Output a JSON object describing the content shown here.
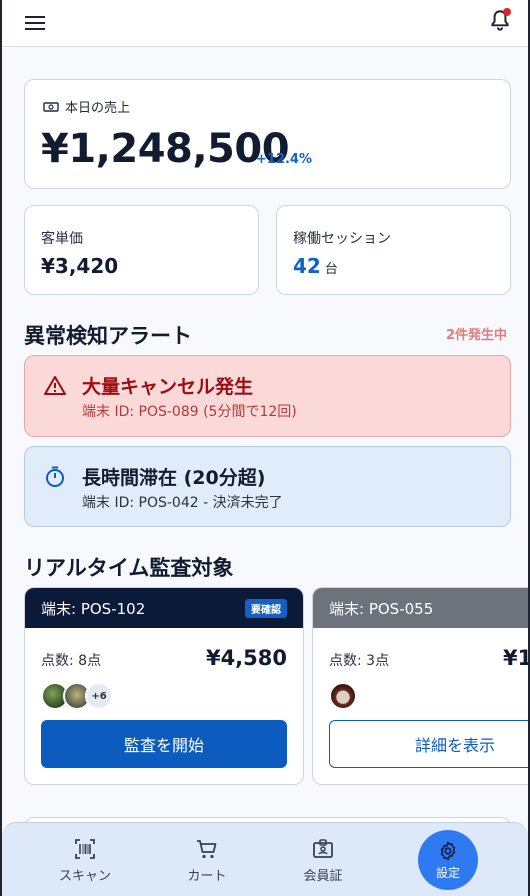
{
  "sales": {
    "label": "本日の売上",
    "value": "¥1,248,500",
    "delta": "+12.4%"
  },
  "metrics": {
    "avg_label": "客単価",
    "avg_value": "¥3,420",
    "sessions_label": "稼働セッション",
    "sessions_value": "42",
    "sessions_unit": "台"
  },
  "alerts": {
    "title": "異常検知アラート",
    "badge": "2件発生中",
    "items": [
      {
        "title": "大量キャンセル発生",
        "sub": "端末 ID: POS-089 (5分間で12回)"
      },
      {
        "title": "長時間滞在 (20分超)",
        "sub": "端末 ID: POS-042 - 決済未完了"
      }
    ]
  },
  "audit": {
    "title": "リアルタイム監査対象",
    "cards": [
      {
        "terminal": "端末: POS-102",
        "tag": "要確認",
        "qty": "点数: 8点",
        "price": "¥4,580",
        "more": "+6",
        "button": "監査を開始"
      },
      {
        "terminal": "端末: POS-055",
        "qty": "点数: 3点",
        "price": "¥1",
        "button": "詳細を表示"
      }
    ]
  },
  "nav": {
    "scan": "スキャン",
    "cart": "カート",
    "member": "会員証",
    "settings": "設定"
  },
  "colors": {
    "primary": "#0c5cc0",
    "navy": "#0c1a3a",
    "alert_red": "#9d0d12",
    "active_nav": "#2f7af0"
  }
}
